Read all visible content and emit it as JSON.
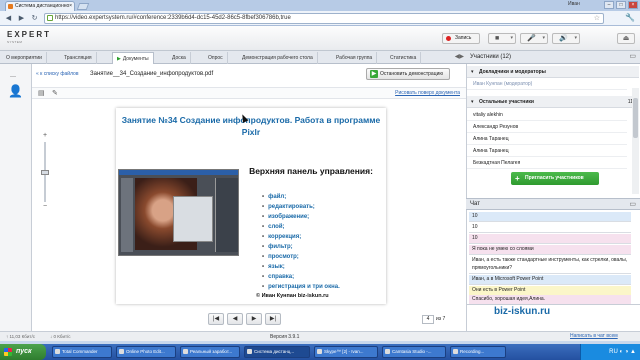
{
  "browser": {
    "tab_title": "Система дистанционно",
    "tab_close": "×",
    "url": "https://video.expertsystem.ru/#conference:2339b6d4-dc15-45d2-86c5-8fbef306786b,true",
    "user": "Иван",
    "back": "◀",
    "forward": "▶",
    "reload": "↻",
    "star": "☆",
    "menu": "🔧",
    "win_min": "–",
    "win_max": "□",
    "win_close": "×"
  },
  "header": {
    "logo": "EXPERT",
    "logo_sub": "SYSTEM",
    "record_label": "Запись",
    "camera_icon": "■",
    "mic_icon": "🎤",
    "speaker_icon": "🔊",
    "caret": "▾",
    "exit_icon": "⏏"
  },
  "tabs": [
    {
      "label": "О мероприятии"
    },
    {
      "label": "Трансляция"
    },
    {
      "label": "Документы"
    },
    {
      "label": "Доска"
    },
    {
      "label": "Опрос"
    },
    {
      "label": "Демонстрация рабочего стола"
    },
    {
      "label": "Рабочая группа"
    },
    {
      "label": "Статистика"
    }
  ],
  "tabs_scroll": "◀▶",
  "document": {
    "back_link": "« к списку файлов",
    "file_name": "Занятие__34_Создание_инфопродуктов.pdf",
    "stop_demo_label": "Остановить демонстрацию",
    "stop_demo_icon": "▶",
    "draw_link": "Рисовать поверх документа",
    "page_current": "4",
    "page_of": "из 7"
  },
  "slide": {
    "title": "Занятие №34 Создание инфопродуктов. Работа в программе Pixlr",
    "panel_heading": "Верхняя панель управления:",
    "items": [
      "файл;",
      "редактировать;",
      "изображение;",
      "слой;",
      "коррекция;",
      "фильтр;",
      "просмотр;",
      "язык;",
      "справка;",
      "регистрация и три окна."
    ],
    "footer": "© Иван Кунпан  biz-iskun.ru"
  },
  "zoom": {
    "plus": "+",
    "minus": "−",
    "level": 0.5
  },
  "pager": {
    "first": "|◀",
    "prev": "◀",
    "next": "▶",
    "last": "▶|"
  },
  "participants": {
    "title": "Участники (12)",
    "collapse": "▭",
    "moderators_heading": "Докладчики и модераторы",
    "moderators": [
      "Иван Кунпан (модератор)"
    ],
    "others_heading": "Остальные участники",
    "others_count": "11",
    "others": [
      "vitaliy alekhin",
      "Александр Резунов",
      "Алина Таранец",
      "Алина Таранец",
      "Безкадтная Пелагея"
    ],
    "invite_label": "Пригласить участников",
    "invite_icon": "+"
  },
  "chat": {
    "title": "Чат",
    "collapse": "▭",
    "messages": [
      {
        "text": "10",
        "color": "blue"
      },
      {
        "text": "10",
        "color": "white"
      },
      {
        "text": "10",
        "color": "pink"
      },
      {
        "text": "Я пока не умею со слоями",
        "color": "pink"
      },
      {
        "text": "Иван, а есть также стандартные инструменты, как стрелки, овалы, прямоугольники?",
        "color": "white"
      },
      {
        "text": "Иван, а в Microsoft Power Point",
        "color": "blue"
      },
      {
        "text": "Они есть в Power Point",
        "color": "yellow"
      },
      {
        "text": "Спасибо, хорошая идея,Алина.",
        "color": "pink"
      }
    ],
    "watermark": "biz-iskun.ru",
    "write_all": "Написать в чат всем"
  },
  "status": {
    "kb_left": "↑ 11,03 Кбит/с",
    "kb_right": "↓ 0 Кбит/с",
    "version": "Версия 3.9.1"
  },
  "taskbar": {
    "start": "пуск",
    "items": [
      {
        "label": "Total Commander"
      },
      {
        "label": "Online Photo Edit..."
      },
      {
        "label": "Реальный заработ..."
      },
      {
        "label": "Система дистанц..."
      },
      {
        "label": "Skype™ [2] - Ivan..."
      },
      {
        "label": "Camtasia Studio -..."
      },
      {
        "label": "Recording..."
      }
    ],
    "tray": "RU  ◐ ◑ ▲"
  }
}
